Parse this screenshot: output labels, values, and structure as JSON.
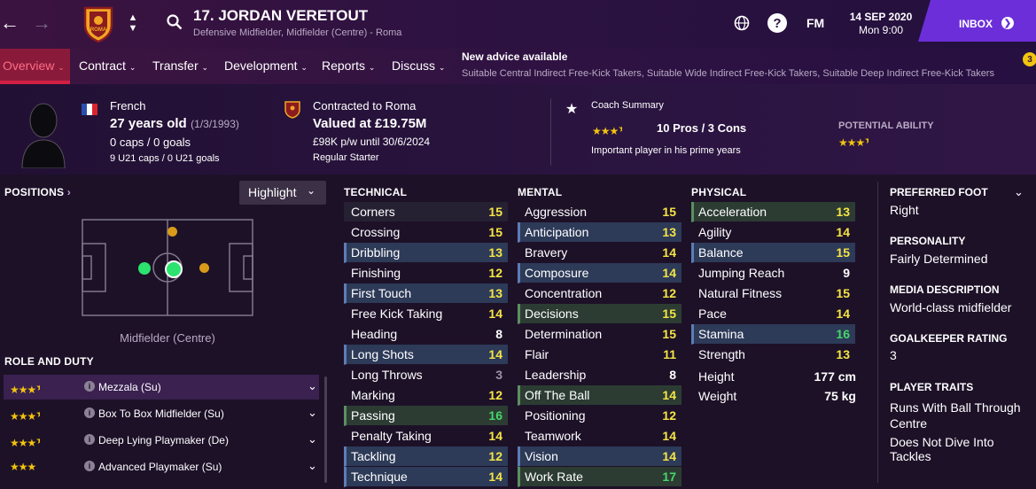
{
  "header": {
    "player_title": "17. JORDAN VERETOUT",
    "player_subtitle": "Defensive Midfielder, Midfielder (Centre) - Roma",
    "club_badge_text": "ROMA",
    "fm_label": "FM",
    "date": "14 SEP 2020",
    "time": "Mon 9:00",
    "inbox_label": "INBOX"
  },
  "nav": {
    "tabs": [
      "Overview",
      "Contract",
      "Transfer",
      "Development",
      "Reports",
      "Discuss"
    ],
    "advice_title": "New advice available",
    "advice_text": "Suitable Central Indirect Free-Kick Takers, Suitable Wide Indirect Free-Kick Takers, Suitable Deep Indirect Free-Kick Takers",
    "notification_count": "3"
  },
  "summary": {
    "nationality": "French",
    "age": "27 years old",
    "dob": "(1/3/1993)",
    "caps": "0 caps / 0 goals",
    "u21": "9 U21 caps / 0 U21 goals",
    "contract_club": "Contracted to Roma",
    "value": "Valued at £19.75M",
    "wage": "£98K p/w until 30/6/2024",
    "squad_status": "Regular Starter",
    "coach_summary_label": "Coach Summary",
    "pros_cons": "10 Pros / 3 Cons",
    "coach_note": "Important player in his prime years",
    "potential_label": "POTENTIAL ABILITY",
    "current_ability_stars": 3.5,
    "potential_ability_stars": 3.5
  },
  "positions": {
    "title": "POSITIONS",
    "highlight_label": "Highlight",
    "current_position": "Midfielder (Centre)",
    "role_duty_title": "ROLE AND DUTY",
    "roles": [
      {
        "name": "Mezzala (Su)",
        "stars": 3.5
      },
      {
        "name": "Box To Box Midfielder (Su)",
        "stars": 3.5
      },
      {
        "name": "Deep Lying Playmaker (De)",
        "stars": 3.5
      },
      {
        "name": "Advanced Playmaker (Su)",
        "stars": 3.0
      }
    ]
  },
  "technical": {
    "title": "TECHNICAL",
    "rows": [
      {
        "name": "Corners",
        "value": "15"
      },
      {
        "name": "Crossing",
        "value": "15"
      },
      {
        "name": "Dribbling",
        "value": "13"
      },
      {
        "name": "Finishing",
        "value": "12"
      },
      {
        "name": "First Touch",
        "value": "13"
      },
      {
        "name": "Free Kick Taking",
        "value": "14"
      },
      {
        "name": "Heading",
        "value": "8"
      },
      {
        "name": "Long Shots",
        "value": "14"
      },
      {
        "name": "Long Throws",
        "value": "3"
      },
      {
        "name": "Marking",
        "value": "12"
      },
      {
        "name": "Passing",
        "value": "16"
      },
      {
        "name": "Penalty Taking",
        "value": "14"
      },
      {
        "name": "Tackling",
        "value": "12"
      },
      {
        "name": "Technique",
        "value": "14"
      }
    ]
  },
  "mental": {
    "title": "MENTAL",
    "rows": [
      {
        "name": "Aggression",
        "value": "15"
      },
      {
        "name": "Anticipation",
        "value": "13"
      },
      {
        "name": "Bravery",
        "value": "14"
      },
      {
        "name": "Composure",
        "value": "14"
      },
      {
        "name": "Concentration",
        "value": "12"
      },
      {
        "name": "Decisions",
        "value": "15"
      },
      {
        "name": "Determination",
        "value": "15"
      },
      {
        "name": "Flair",
        "value": "11"
      },
      {
        "name": "Leadership",
        "value": "8"
      },
      {
        "name": "Off The Ball",
        "value": "14"
      },
      {
        "name": "Positioning",
        "value": "12"
      },
      {
        "name": "Teamwork",
        "value": "14"
      },
      {
        "name": "Vision",
        "value": "14"
      },
      {
        "name": "Work Rate",
        "value": "17"
      }
    ]
  },
  "physical": {
    "title": "PHYSICAL",
    "rows": [
      {
        "name": "Acceleration",
        "value": "13"
      },
      {
        "name": "Agility",
        "value": "14"
      },
      {
        "name": "Balance",
        "value": "15"
      },
      {
        "name": "Jumping Reach",
        "value": "9"
      },
      {
        "name": "Natural Fitness",
        "value": "15"
      },
      {
        "name": "Pace",
        "value": "14"
      },
      {
        "name": "Stamina",
        "value": "16"
      },
      {
        "name": "Strength",
        "value": "13"
      }
    ],
    "height_label": "Height",
    "height": "177 cm",
    "weight_label": "Weight",
    "weight": "75 kg"
  },
  "profile": {
    "preferred_foot_label": "PREFERRED FOOT",
    "preferred_foot": "Right",
    "personality_label": "PERSONALITY",
    "personality": "Fairly Determined",
    "media_label": "MEDIA DESCRIPTION",
    "media": "World-class midfielder",
    "gk_label": "GOALKEEPER RATING",
    "gk": "3",
    "traits_label": "PLAYER TRAITS",
    "traits": [
      "Runs With Ball Through Centre",
      "Does Not Dive Into Tackles"
    ]
  },
  "colors": {
    "accent_red": "#d21f44",
    "inbox_purple": "#6c2ed8",
    "value_yellow": "#f5e544",
    "value_green": "#46d769",
    "star_gold": "#f2c40f"
  }
}
